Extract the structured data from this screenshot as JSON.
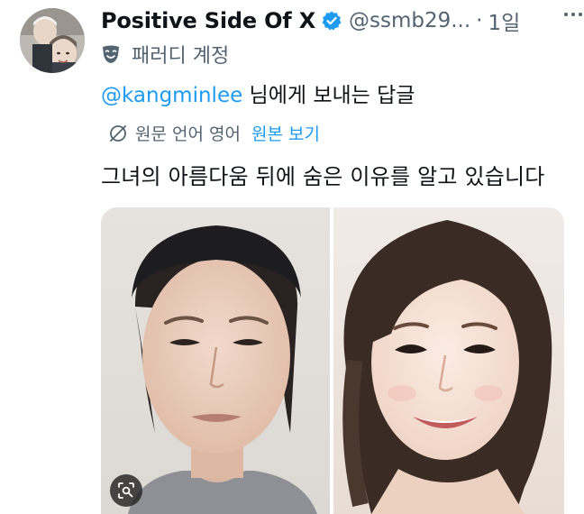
{
  "post": {
    "author_name": "Positive Side Of X",
    "author_handle": "@ssmb29...",
    "separator": "·",
    "timestamp": "1일",
    "parody_label": "패러디 계정",
    "reply_to_handle": "@kangminlee",
    "reply_to_suffix": " 님에게 보내는 답글",
    "translation_note": "원문 언어 영어",
    "show_original_label": "원본 보기",
    "text": "그녀의 아름다움 뒤에 숨은 이유를 알고 있습니다"
  },
  "icons": {
    "verified": "verified-badge-icon",
    "parody": "theater-mask-icon",
    "translate": "translate-off-icon",
    "more": "more-options-icon",
    "lens": "visual-search-icon"
  },
  "colors": {
    "link": "#1d9bf0",
    "secondary_text": "#536471",
    "primary_text": "#0f1419",
    "verified_badge": "#1d9bf0"
  }
}
